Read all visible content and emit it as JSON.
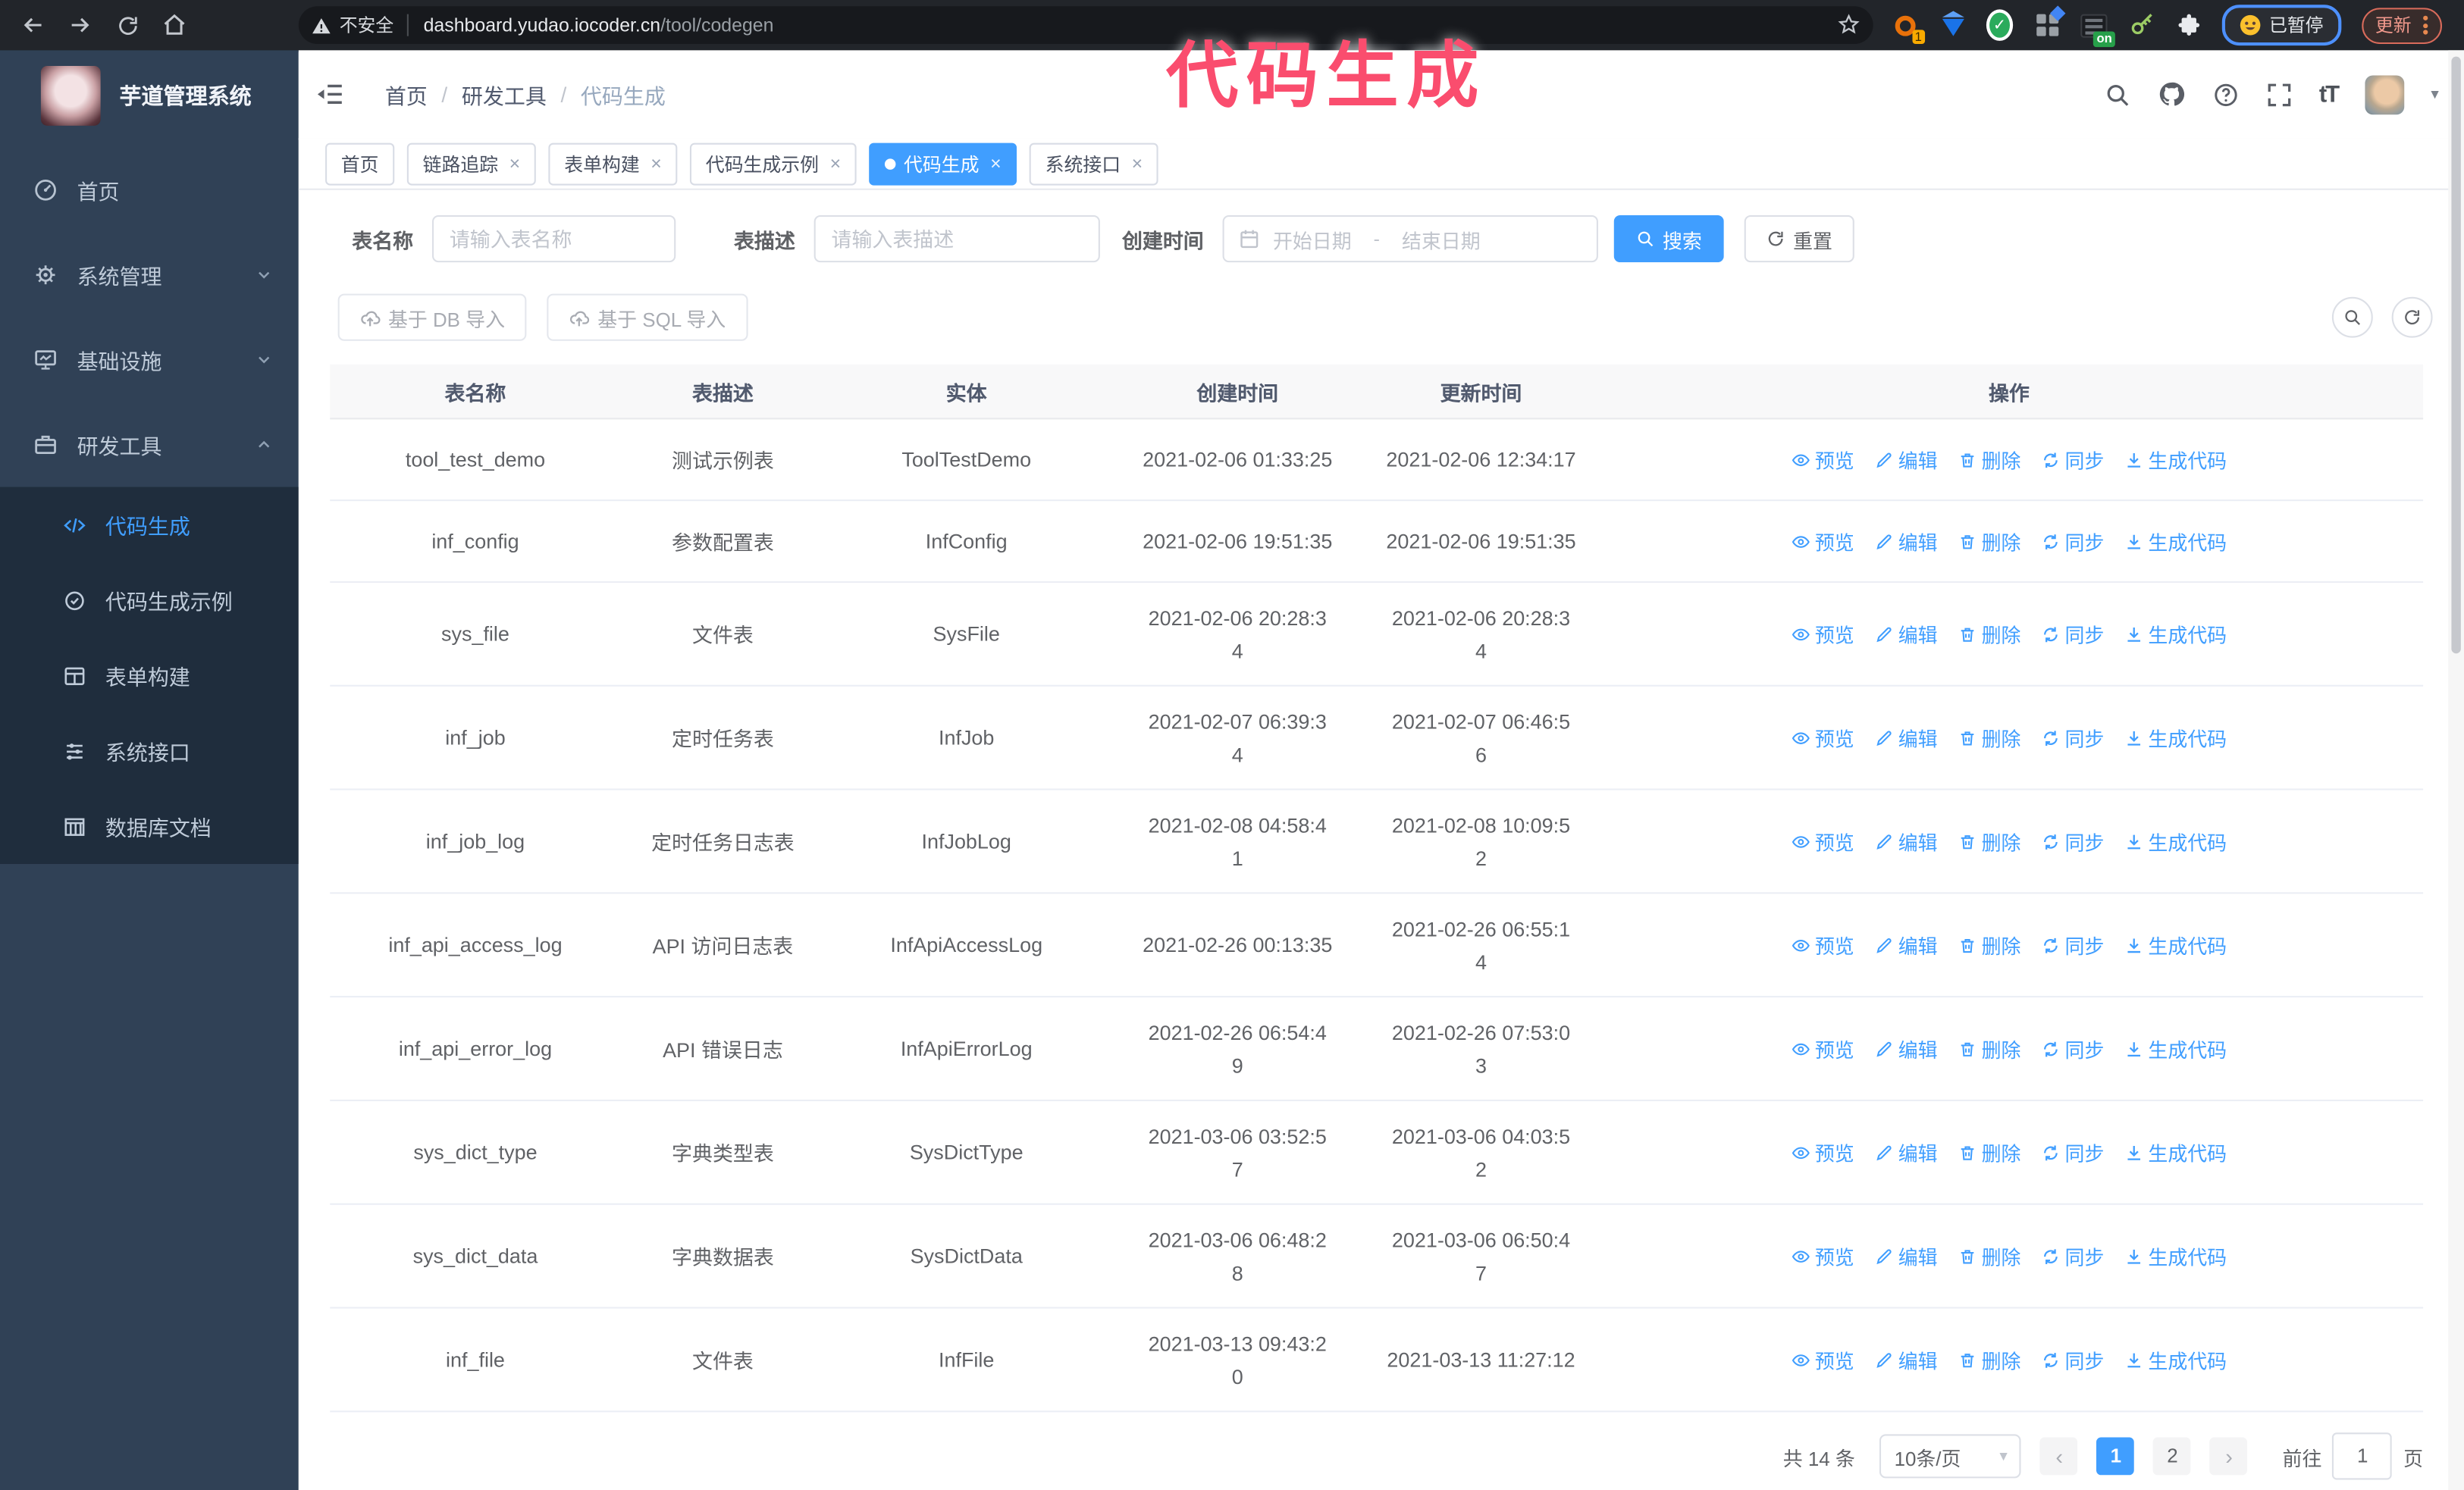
{
  "ui": {
    "close": "×",
    "breadcrumb_sep": "/",
    "font_size_icon": "tT",
    "caret": "▾",
    "prev": "‹",
    "next": "›"
  },
  "browser": {
    "security_label": "不安全",
    "url_host": "dashboard.yudao.iocoder.cn",
    "url_path": "/tool/codegen",
    "ext_badge": "1",
    "ext_on_badge": "on",
    "paused_label": "已暂停",
    "update_label": "更新"
  },
  "overlay_title": "代码生成",
  "sidebar": {
    "title": "芋道管理系统",
    "items": [
      {
        "label": "首页"
      },
      {
        "label": "系统管理"
      },
      {
        "label": "基础设施"
      },
      {
        "label": "研发工具"
      }
    ],
    "subitems": [
      {
        "label": "代码生成"
      },
      {
        "label": "代码生成示例"
      },
      {
        "label": "表单构建"
      },
      {
        "label": "系统接口"
      },
      {
        "label": "数据库文档"
      }
    ]
  },
  "breadcrumb": [
    "首页",
    "研发工具",
    "代码生成"
  ],
  "tags": [
    "首页",
    "链路追踪",
    "表单构建",
    "代码生成示例",
    "代码生成",
    "系统接口"
  ],
  "filters": {
    "name_label": "表名称",
    "name_placeholder": "请输入表名称",
    "desc_label": "表描述",
    "desc_placeholder": "请输入表描述",
    "time_label": "创建时间",
    "start_placeholder": "开始日期",
    "range_separator": "-",
    "end_placeholder": "结束日期",
    "search_label": "搜索",
    "reset_label": "重置"
  },
  "toolbar": {
    "import_db_label": "基于 DB 导入",
    "import_sql_label": "基于 SQL 导入"
  },
  "table": {
    "columns": [
      "表名称",
      "表描述",
      "实体",
      "创建时间",
      "更新时间",
      "操作"
    ],
    "actions": [
      "预览",
      "编辑",
      "删除",
      "同步",
      "生成代码"
    ],
    "rows": [
      {
        "name": "tool_test_demo",
        "desc": "测试示例表",
        "entity": "ToolTestDemo",
        "created": "2021-02-06 01:33:25",
        "updated": "2021-02-06 12:34:17"
      },
      {
        "name": "inf_config",
        "desc": "参数配置表",
        "entity": "InfConfig",
        "created": "2021-02-06 19:51:35",
        "updated": "2021-02-06 19:51:35"
      },
      {
        "name": "sys_file",
        "desc": "文件表",
        "entity": "SysFile",
        "created": "2021-02-06 20:28:3\n4",
        "updated": "2021-02-06 20:28:3\n4"
      },
      {
        "name": "inf_job",
        "desc": "定时任务表",
        "entity": "InfJob",
        "created": "2021-02-07 06:39:3\n4",
        "updated": "2021-02-07 06:46:5\n6"
      },
      {
        "name": "inf_job_log",
        "desc": "定时任务日志表",
        "entity": "InfJobLog",
        "created": "2021-02-08 04:58:4\n1",
        "updated": "2021-02-08 10:09:5\n2"
      },
      {
        "name": "inf_api_access_log",
        "desc": "API 访问日志表",
        "entity": "InfApiAccessLog",
        "created": "2021-02-26 00:13:35",
        "updated": "2021-02-26 06:55:1\n4"
      },
      {
        "name": "inf_api_error_log",
        "desc": "API 错误日志",
        "entity": "InfApiErrorLog",
        "created": "2021-02-26 06:54:4\n9",
        "updated": "2021-02-26 07:53:0\n3"
      },
      {
        "name": "sys_dict_type",
        "desc": "字典类型表",
        "entity": "SysDictType",
        "created": "2021-03-06 03:52:5\n7",
        "updated": "2021-03-06 04:03:5\n2"
      },
      {
        "name": "sys_dict_data",
        "desc": "字典数据表",
        "entity": "SysDictData",
        "created": "2021-03-06 06:48:2\n8",
        "updated": "2021-03-06 06:50:4\n7"
      },
      {
        "name": "inf_file",
        "desc": "文件表",
        "entity": "InfFile",
        "created": "2021-03-13 09:43:2\n0",
        "updated": "2021-03-13 11:27:12"
      }
    ]
  },
  "pagination": {
    "total": "共 14 条",
    "page_size": "10条/页",
    "pages": [
      "1",
      "2"
    ],
    "active_page": "1",
    "goto_label": "前往",
    "goto_value": "1",
    "page_unit": "页"
  },
  "colors": {
    "accent": "#409eff",
    "sidebar_bg": "#304156",
    "submenu_bg": "#1f2d3d",
    "overlay_title": "#fa4d6e",
    "table_header_bg": "#f8f8f9",
    "link": "#409eff"
  }
}
